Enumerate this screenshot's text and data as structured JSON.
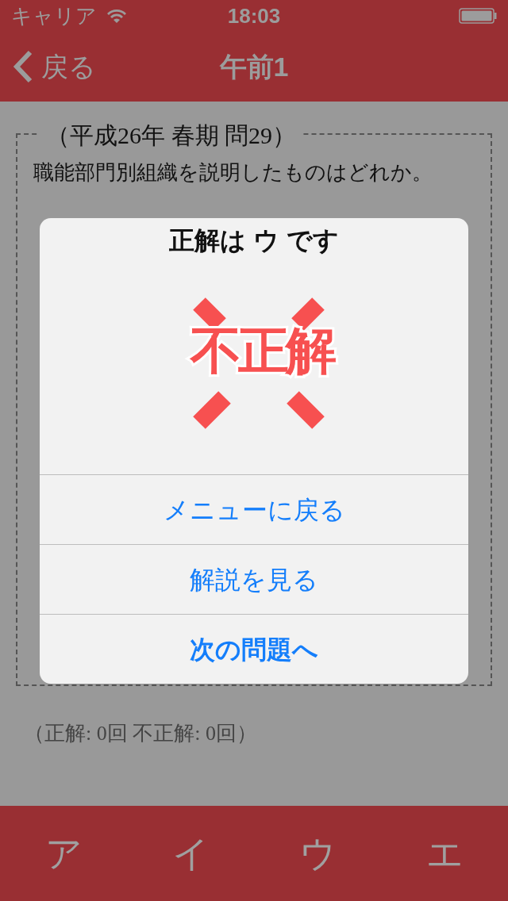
{
  "status_bar": {
    "carrier": "キャリア",
    "time": "18:03"
  },
  "nav": {
    "back": "戻る",
    "title": "午前1"
  },
  "question": {
    "source": "（平成26年 春期 問29）",
    "text": "職能部門別組織を説明したものはどれか。"
  },
  "stats": "（正解: 0回 不正解: 0回）",
  "answer_tabs": [
    {
      "label": "ア"
    },
    {
      "label": "イ"
    },
    {
      "label": "ウ"
    },
    {
      "label": "エ"
    }
  ],
  "alert": {
    "title": "正解は ウ です",
    "stamp": "不正解",
    "buttons": [
      {
        "label": "メニューに戻る",
        "bold": false
      },
      {
        "label": "解説を見る",
        "bold": false
      },
      {
        "label": "次の問題へ",
        "bold": true
      }
    ]
  }
}
